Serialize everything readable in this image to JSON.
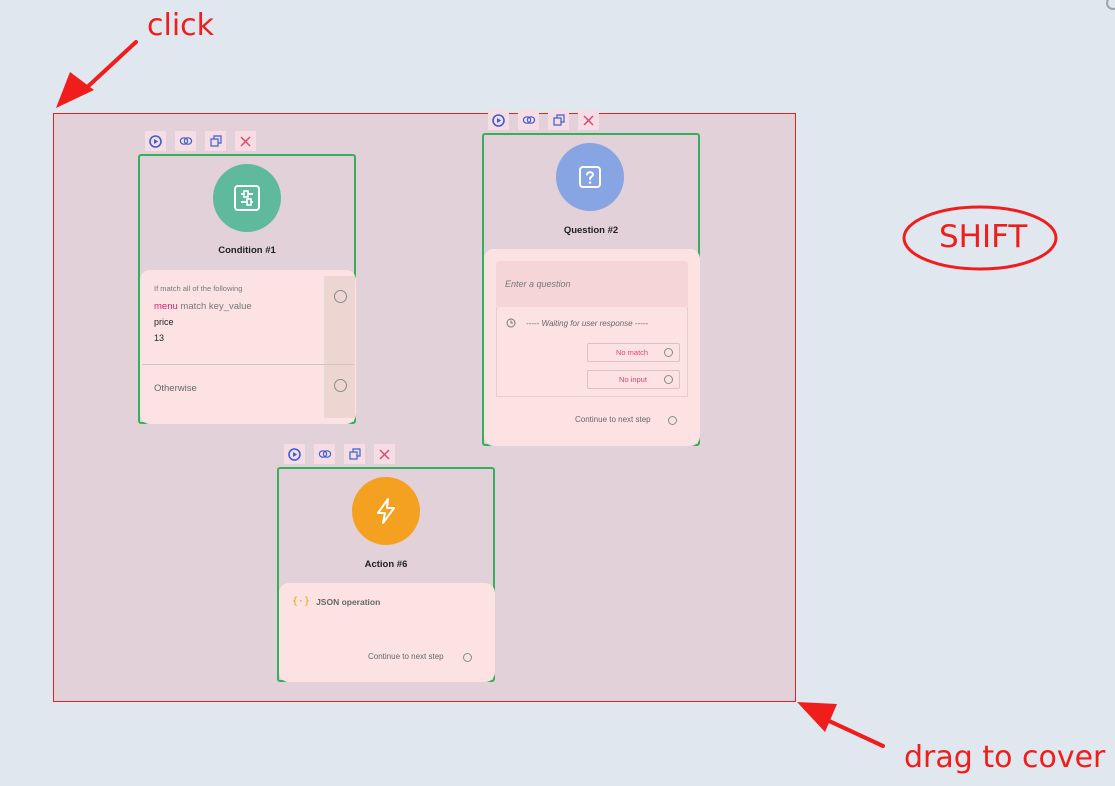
{
  "annotations": {
    "click": "click",
    "shift": "SHIFT",
    "drag": "drag to cover"
  },
  "toolbar_icons": [
    "play-icon",
    "link-icon",
    "duplicate-icon",
    "close-icon"
  ],
  "nodes": {
    "condition": {
      "title": "Condition #1",
      "icon": "condition-sliders-icon",
      "color": "#5fb99c",
      "rule_header": "If match all of the following",
      "rule_keyword": "menu",
      "rule_text": "match key_value",
      "rule_key": "price",
      "rule_value": "13",
      "otherwise": "Otherwise"
    },
    "question": {
      "title": "Question #2",
      "icon": "question-icon",
      "color": "#86a5e2",
      "placeholder": "Enter a question",
      "waiting": "----- Waiting for user response -----",
      "no_match": "No match",
      "no_input": "No input",
      "continue": "Continue to next step"
    },
    "action": {
      "title": "Action #6",
      "icon": "lightning-icon",
      "color": "#f4a020",
      "operation": "JSON operation",
      "continue": "Continue to next step"
    }
  },
  "colors": {
    "selection_border": "#e02424",
    "node_border": "#35b05a",
    "annotation": "#f01d1d",
    "toolbar_icon": "#3b5fd1",
    "delete_icon": "#e5466b"
  }
}
